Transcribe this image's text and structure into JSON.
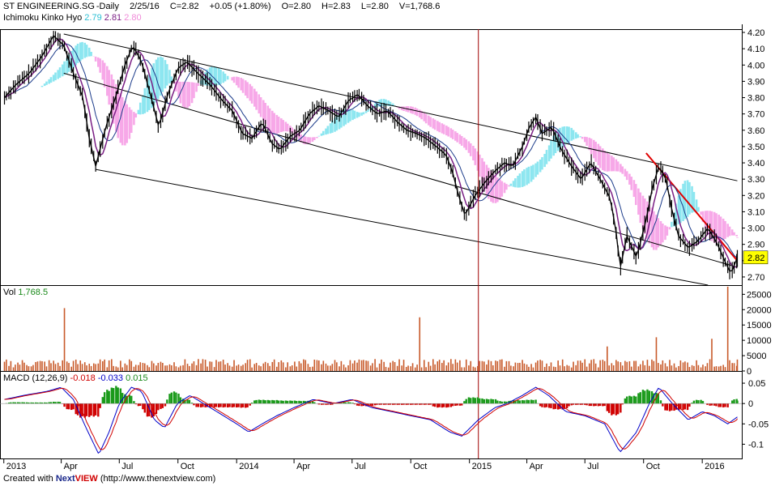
{
  "header": {
    "symbol": "ST ENGINEERING.SG",
    "interval": "-Daily",
    "date": "2/25/16",
    "close": "C=2.82",
    "change": "+0.05 (+1.80%)",
    "open": "O=2.80",
    "high": "H=2.83",
    "low": "L=2.80",
    "volume": "V=1,768.6"
  },
  "ichimoku": {
    "label": "Ichimoku Kinko Hyo",
    "v1": "2.79",
    "v2": "2.81",
    "v3": "2.80",
    "c1": "#2bbfd4",
    "c2": "#7a1e84",
    "c3": "#f08ad8"
  },
  "vol_panel": {
    "label": "Vol",
    "value": "1,768.5",
    "value_color": "#1a8a1a"
  },
  "macd_panel": {
    "label": "MACD (12,26,9)",
    "v1": "-0.018",
    "v2": "-0.033",
    "v3": "0.015",
    "c1": "#d00000",
    "c2": "#0000c8",
    "c3": "#1a8a1a"
  },
  "footer": {
    "prefix": "Created with ",
    "brand1": "Next",
    "brand2": "VIEW",
    "url": "(http://www.thenextview.com)"
  },
  "last_price": "2.82",
  "colors": {
    "price": "#000000",
    "tenkan": "#7a1e84",
    "kijun": "#000000",
    "kumo_bull": "#8ce6f0",
    "kumo_bear": "#f7a8e8",
    "vol_bar": "#c85a2a",
    "macd_line": "#0000c8",
    "signal_line": "#d00000",
    "hist_pos": "#1a9a1a",
    "hist_neg": "#d00000",
    "trend_red": "#e00000",
    "channel": "#000000",
    "cursor": "#a00000",
    "last_box": "#ffff00"
  },
  "chart_data": [
    {
      "type": "candlestick",
      "title": "ST ENGINEERING.SG -Daily",
      "ylim": [
        2.65,
        4.22
      ],
      "y_ticks": [
        "4.20",
        "4.10",
        "4.00",
        "3.90",
        "3.80",
        "3.70",
        "3.60",
        "3.50",
        "3.40",
        "3.30",
        "3.20",
        "3.10",
        "3.00",
        "2.90",
        "2.80",
        "2.70"
      ],
      "x_ticks": [
        "2013",
        "Apr",
        "Jul",
        "Oct",
        "2014",
        "Apr",
        "Jul",
        "Oct",
        "2015",
        "Apr",
        "Jul",
        "Oct",
        "2016"
      ],
      "close_path": [
        [
          "2013-01-02",
          3.8
        ],
        [
          "2013-01-20",
          3.88
        ],
        [
          "2013-02-10",
          3.95
        ],
        [
          "2013-03-01",
          4.05
        ],
        [
          "2013-03-20",
          4.18
        ],
        [
          "2013-04-05",
          4.12
        ],
        [
          "2013-04-20",
          3.95
        ],
        [
          "2013-05-05",
          3.8
        ],
        [
          "2013-05-15",
          3.55
        ],
        [
          "2013-05-25",
          3.38
        ],
        [
          "2013-06-10",
          3.62
        ],
        [
          "2013-06-25",
          3.8
        ],
        [
          "2013-07-10",
          4.0
        ],
        [
          "2013-07-22",
          4.12
        ],
        [
          "2013-08-05",
          4.02
        ],
        [
          "2013-08-20",
          3.8
        ],
        [
          "2013-09-01",
          3.62
        ],
        [
          "2013-09-15",
          3.82
        ],
        [
          "2013-10-01",
          3.98
        ],
        [
          "2013-10-15",
          4.02
        ],
        [
          "2013-11-01",
          3.95
        ],
        [
          "2013-11-20",
          3.88
        ],
        [
          "2013-12-10",
          3.78
        ],
        [
          "2013-12-25",
          3.72
        ],
        [
          "2014-01-10",
          3.58
        ],
        [
          "2014-01-25",
          3.55
        ],
        [
          "2014-02-10",
          3.65
        ],
        [
          "2014-02-25",
          3.52
        ],
        [
          "2014-03-10",
          3.48
        ],
        [
          "2014-03-25",
          3.56
        ],
        [
          "2014-04-10",
          3.6
        ],
        [
          "2014-04-25",
          3.7
        ],
        [
          "2014-05-10",
          3.75
        ],
        [
          "2014-05-25",
          3.72
        ],
        [
          "2014-06-10",
          3.68
        ],
        [
          "2014-06-25",
          3.78
        ],
        [
          "2014-07-10",
          3.82
        ],
        [
          "2014-07-25",
          3.75
        ],
        [
          "2014-08-10",
          3.7
        ],
        [
          "2014-08-25",
          3.72
        ],
        [
          "2014-09-10",
          3.65
        ],
        [
          "2014-09-25",
          3.6
        ],
        [
          "2014-10-10",
          3.58
        ],
        [
          "2014-10-25",
          3.55
        ],
        [
          "2014-11-10",
          3.5
        ],
        [
          "2014-11-25",
          3.45
        ],
        [
          "2014-12-05",
          3.35
        ],
        [
          "2014-12-15",
          3.2
        ],
        [
          "2014-12-25",
          3.08
        ],
        [
          "2015-01-10",
          3.2
        ],
        [
          "2015-01-25",
          3.28
        ],
        [
          "2015-02-10",
          3.35
        ],
        [
          "2015-02-25",
          3.4
        ],
        [
          "2015-03-10",
          3.38
        ],
        [
          "2015-03-25",
          3.5
        ],
        [
          "2015-04-05",
          3.62
        ],
        [
          "2015-04-15",
          3.68
        ],
        [
          "2015-04-25",
          3.58
        ],
        [
          "2015-05-10",
          3.62
        ],
        [
          "2015-05-25",
          3.48
        ],
        [
          "2015-06-10",
          3.38
        ],
        [
          "2015-06-25",
          3.3
        ],
        [
          "2015-07-10",
          3.4
        ],
        [
          "2015-07-25",
          3.3
        ],
        [
          "2015-08-10",
          3.18
        ],
        [
          "2015-08-20",
          2.95
        ],
        [
          "2015-08-25",
          2.75
        ],
        [
          "2015-09-05",
          2.95
        ],
        [
          "2015-09-20",
          2.82
        ],
        [
          "2015-10-05",
          3.05
        ],
        [
          "2015-10-15",
          3.25
        ],
        [
          "2015-10-25",
          3.38
        ],
        [
          "2015-11-05",
          3.3
        ],
        [
          "2015-11-15",
          3.1
        ],
        [
          "2015-11-25",
          2.95
        ],
        [
          "2015-12-10",
          2.88
        ],
        [
          "2015-12-25",
          2.92
        ],
        [
          "2016-01-10",
          3.0
        ],
        [
          "2016-01-25",
          2.9
        ],
        [
          "2016-02-05",
          2.8
        ],
        [
          "2016-02-15",
          2.72
        ],
        [
          "2016-02-25",
          2.82
        ]
      ],
      "trend_line": [
        [
          "2015-10-05",
          3.46
        ],
        [
          "2016-02-25",
          2.8
        ]
      ],
      "channel_upper": [
        [
          "2013-04-05",
          4.19
        ],
        [
          "2016-02-25",
          3.29
        ]
      ],
      "channel_mid": [
        [
          "2013-04-05",
          3.95
        ],
        [
          "2016-02-25",
          2.76
        ]
      ],
      "channel_lower": [
        [
          "2013-05-25",
          3.36
        ],
        [
          "2016-01-10",
          2.65
        ]
      ],
      "cursor_date": "2015-01-15"
    },
    {
      "type": "bar",
      "title": "Vol",
      "ylim": [
        0,
        28000
      ],
      "y_ticks": [
        "25000",
        "20000",
        "15000",
        "10000",
        "5000",
        "0"
      ],
      "spikes": [
        [
          "2013-04-05",
          20500
        ],
        [
          "2014-10-15",
          17500
        ],
        [
          "2015-08-05",
          8000
        ],
        [
          "2015-10-20",
          11000
        ],
        [
          "2016-01-15",
          10500
        ],
        [
          "2016-02-10",
          27500
        ]
      ],
      "baseline_typical": 2800
    },
    {
      "type": "line",
      "title": "MACD (12,26,9)",
      "ylim": [
        -0.135,
        0.08
      ],
      "y_ticks": [
        "0.05",
        "0",
        "-0.05",
        "-0.1"
      ],
      "macd": [
        [
          "2013-01-02",
          0.01
        ],
        [
          "2013-02-01",
          0.02
        ],
        [
          "2013-03-10",
          0.03
        ],
        [
          "2013-04-01",
          0.04
        ],
        [
          "2013-04-20",
          0.01
        ],
        [
          "2013-05-10",
          -0.06
        ],
        [
          "2013-05-30",
          -0.125
        ],
        [
          "2013-06-15",
          -0.07
        ],
        [
          "2013-07-01",
          0.0
        ],
        [
          "2013-07-20",
          0.04
        ],
        [
          "2013-08-05",
          0.03
        ],
        [
          "2013-08-25",
          -0.04
        ],
        [
          "2013-09-10",
          -0.06
        ],
        [
          "2013-09-30",
          0.0
        ],
        [
          "2013-10-20",
          0.02
        ],
        [
          "2013-11-10",
          0.0
        ],
        [
          "2013-12-01",
          -0.02
        ],
        [
          "2014-01-01",
          -0.05
        ],
        [
          "2014-01-20",
          -0.07
        ],
        [
          "2014-02-10",
          -0.05
        ],
        [
          "2014-03-05",
          -0.03
        ],
        [
          "2014-04-01",
          -0.01
        ],
        [
          "2014-05-01",
          0.01
        ],
        [
          "2014-06-01",
          0.0
        ],
        [
          "2014-07-01",
          0.01
        ],
        [
          "2014-08-01",
          -0.01
        ],
        [
          "2014-09-01",
          -0.02
        ],
        [
          "2014-10-01",
          -0.03
        ],
        [
          "2014-11-01",
          -0.04
        ],
        [
          "2014-12-01",
          -0.07
        ],
        [
          "2014-12-20",
          -0.08
        ],
        [
          "2015-01-15",
          -0.04
        ],
        [
          "2015-02-10",
          -0.01
        ],
        [
          "2015-03-01",
          0.0
        ],
        [
          "2015-03-25",
          0.02
        ],
        [
          "2015-04-15",
          0.04
        ],
        [
          "2015-05-05",
          0.02
        ],
        [
          "2015-06-01",
          -0.02
        ],
        [
          "2015-07-01",
          -0.03
        ],
        [
          "2015-08-01",
          -0.05
        ],
        [
          "2015-08-25",
          -0.12
        ],
        [
          "2015-09-20",
          -0.07
        ],
        [
          "2015-10-10",
          0.0
        ],
        [
          "2015-10-25",
          0.04
        ],
        [
          "2015-11-15",
          0.0
        ],
        [
          "2015-12-10",
          -0.04
        ],
        [
          "2016-01-01",
          -0.02
        ],
        [
          "2016-01-20",
          -0.03
        ],
        [
          "2016-02-10",
          -0.05
        ],
        [
          "2016-02-25",
          -0.033
        ]
      ]
    }
  ]
}
